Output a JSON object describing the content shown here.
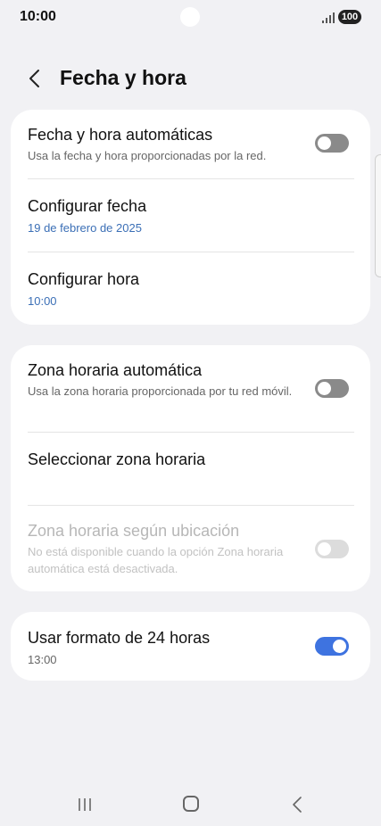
{
  "status_bar": {
    "time": "10:00",
    "battery": "100",
    "icons": [
      "signal-icon",
      "battery-icon"
    ]
  },
  "header": {
    "title": "Fecha y hora",
    "back_icon": "chevron-left-icon"
  },
  "card1": {
    "auto_datetime": {
      "title": "Fecha y hora automáticas",
      "subtitle": "Usa la fecha y hora proporcionadas por la red.",
      "toggle": "off"
    },
    "set_date": {
      "title": "Configurar fecha",
      "value": "19 de febrero de 2025"
    },
    "set_time": {
      "title": "Configurar hora",
      "value": "10:00"
    }
  },
  "card2": {
    "auto_timezone": {
      "title": "Zona horaria automática",
      "subtitle": "Usa la zona horaria proporcionada por tu red móvil.",
      "toggle": "off"
    },
    "select_timezone": {
      "title": "Seleccionar zona horaria"
    },
    "location_timezone": {
      "title": "Zona horaria según ubicación",
      "subtitle": "No está disponible cuando la opción Zona horaria automática está desactivada.",
      "toggle": "off-disabled"
    }
  },
  "card3": {
    "format_24h": {
      "title": "Usar formato de 24 horas",
      "value": "13:00",
      "toggle": "on"
    }
  },
  "colors": {
    "accent": "#3e73e0",
    "link_blue": "#3b6fb6",
    "background": "#f1f1f4",
    "card": "#ffffff"
  },
  "nav_bar": {
    "icons": [
      "recents-icon",
      "home-icon",
      "back-icon"
    ]
  }
}
